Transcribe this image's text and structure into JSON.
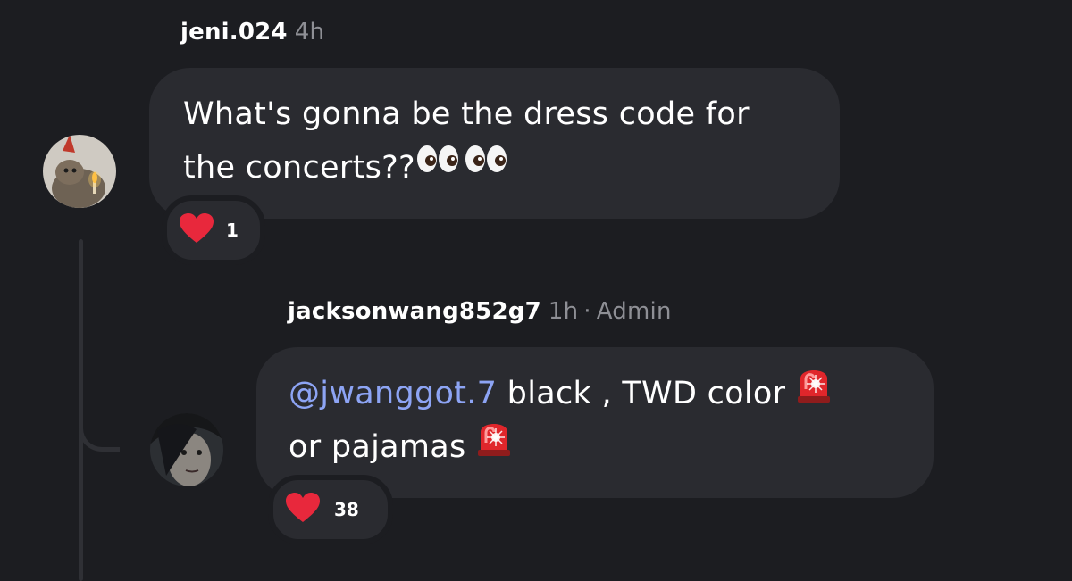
{
  "comment": {
    "username": "jeni.024",
    "time": "4h",
    "text_line1": "What's gonna be the dress code for",
    "text_line2": "the concerts??",
    "line2_emojis": [
      "eyes-emoji",
      "eyes-emoji"
    ],
    "reaction": {
      "icon": "heart-icon",
      "count": "1"
    }
  },
  "reply": {
    "username": "jacksonwang852g7",
    "time": "1h",
    "separator": "·",
    "role": "Admin",
    "mention": "@jwanggot.7",
    "text_line1": " black , TWD color ",
    "line1_emoji": "police-light-emoji",
    "text_line2": "or pajamas ",
    "line2_emoji": "police-light-emoji",
    "reaction": {
      "icon": "heart-icon",
      "count": "38"
    }
  },
  "colors": {
    "background": "#1c1d21",
    "bubble": "#2a2b30",
    "muted_text": "#8e8f95",
    "mention": "#8da4f4",
    "heart": "#e8283c"
  }
}
